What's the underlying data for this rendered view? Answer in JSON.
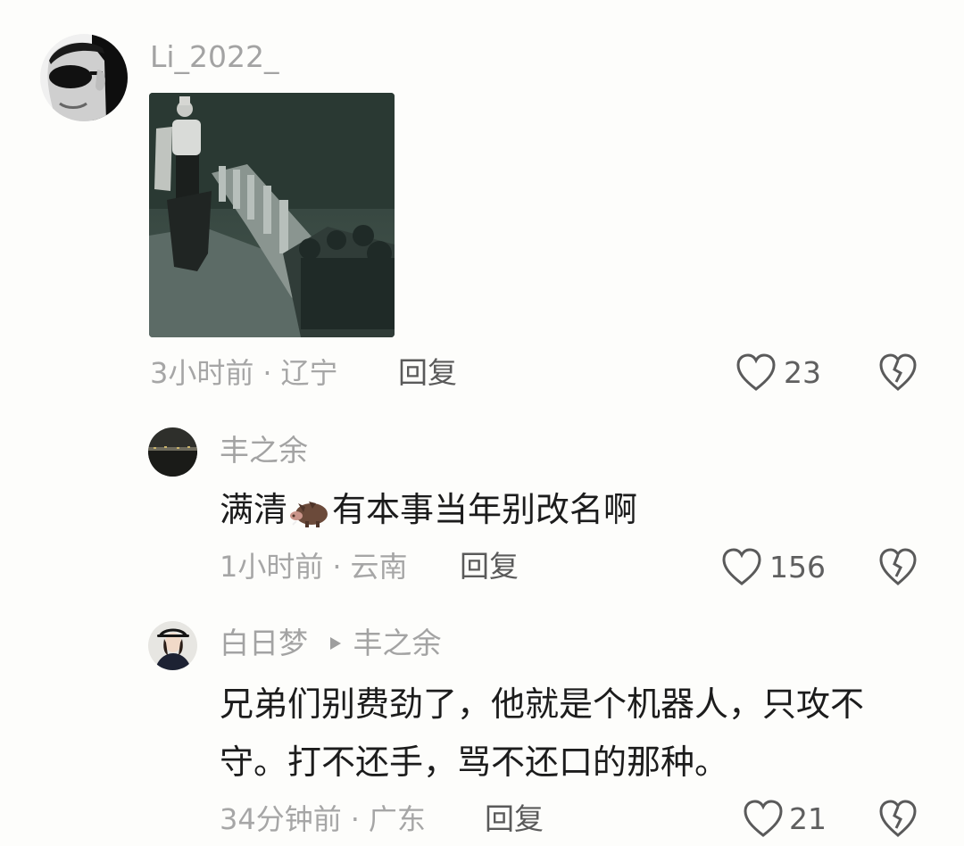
{
  "comments": [
    {
      "username": "Li_2022_",
      "avatar_icon": "sunglasses-man-avatar",
      "attachment_icon": "horse-rider-bridge-image",
      "time": "3小时前",
      "location": "辽宁",
      "reply_label": "回复",
      "likes": "23"
    },
    {
      "username": "丰之余",
      "avatar_icon": "night-cityscape-avatar",
      "text_before": "满清",
      "emoji_icon": "boar-emoji",
      "text_after": "有本事当年别改名啊",
      "time": "1小时前",
      "location": "云南",
      "reply_label": "回复",
      "likes": "156"
    },
    {
      "username": "白日梦",
      "avatar_icon": "woman-hat-avatar",
      "reply_to": "丰之余",
      "text_line1": "兄弟们别费劲了，他就是个机器人，只攻不",
      "text_line2": "守。打不还手，骂不还口的那种。",
      "time": "34分钟前",
      "location": "广东",
      "reply_label": "回复",
      "likes": "21"
    }
  ],
  "separator": "·",
  "colors": {
    "background": "#fdfdfb",
    "muted": "#a6a6a6",
    "text": "#1c1c1c"
  }
}
